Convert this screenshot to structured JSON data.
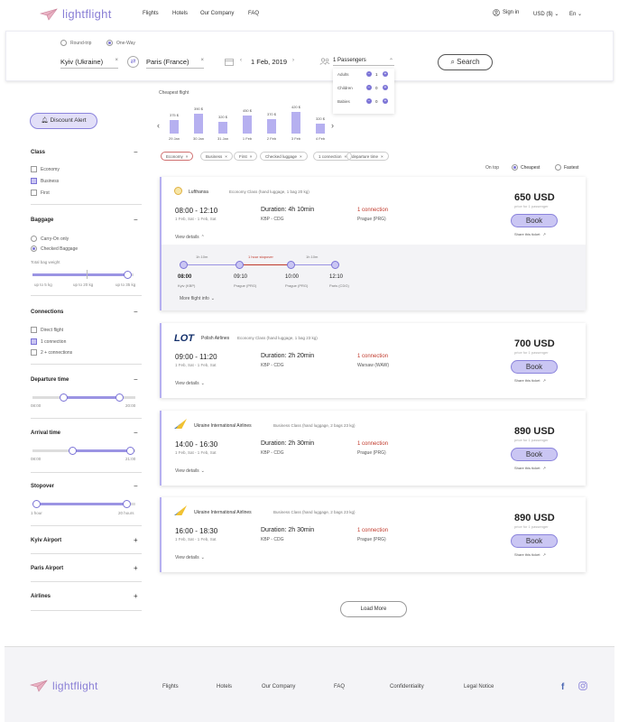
{
  "brand": {
    "name": "lightflight",
    "accent": "#8a7fd6"
  },
  "header": {
    "nav": [
      "Flights",
      "Hotels",
      "Our Company",
      "FAQ"
    ],
    "sign_in": "Sign in",
    "currency": "USD ($)",
    "language": "En"
  },
  "search": {
    "trip_round": "Round-trip",
    "trip_oneway": "One-Way",
    "from": "Kyiv (Ukraine)",
    "to": "Paris (France)",
    "date": "1 Feb, 2019",
    "passengers": "1 Passengers",
    "search_label": "Search",
    "pax_rows": [
      {
        "label": "Adults",
        "count": "1"
      },
      {
        "label": "Children",
        "count": "0"
      },
      {
        "label": "Babies",
        "count": "0"
      }
    ]
  },
  "sidebar": {
    "discount": "Discount Alert",
    "class_title": "Class",
    "class_items": [
      "Economy",
      "Business",
      "First"
    ],
    "baggage_title": "Baggage",
    "baggage_items": [
      "Carry-On only",
      "Checked Baggage"
    ],
    "total_weight": "Total bag weight",
    "weight_ticks": [
      "up to 5 kg",
      "up to 20 kg",
      "up to 35 kg"
    ],
    "connections_title": "Connections",
    "connections_items": [
      "Direct flight",
      "1 connection",
      "2 + connections"
    ],
    "departure_title": "Departure time",
    "departure_range": [
      "08:00",
      "20:00"
    ],
    "arrival_title": "Arrival time",
    "arrival_range": [
      "08:00",
      "21:00"
    ],
    "stopover_title": "Stopover",
    "stopover_range": [
      "1 hour",
      "20 hours"
    ],
    "kyiv_airport": "Kyiv Airport",
    "paris_airport": "Paris Airport",
    "airlines": "Airlines"
  },
  "cheapest_title": "Cheapest flight",
  "cheapest_bars": [
    {
      "price": "375 $",
      "date": "29 Jan",
      "height": 0.55
    },
    {
      "price": "390 $",
      "date": "30 Jan",
      "height": 0.78
    },
    {
      "price": "320 $",
      "date": "31 Jan",
      "height": 0.45
    },
    {
      "price": "450 $",
      "date": "1 Feb",
      "height": 0.72
    },
    {
      "price": "370 $",
      "date": "2 Feb",
      "height": 0.58
    },
    {
      "price": "420 $",
      "date": "3 Feb",
      "height": 0.85
    },
    {
      "price": "320 $",
      "date": "4 Feb",
      "height": 0.38
    }
  ],
  "chips": [
    "Economy",
    "Business",
    "First",
    "Checked luggage",
    "1 connection",
    "departure time"
  ],
  "sort": {
    "on_top": "On top",
    "cheapest": "Cheapest",
    "fastest": "Fastest"
  },
  "flights": [
    {
      "airline": "Lufthansa",
      "info": "Economy Class (hand luggage, 1 bag 20 kg)",
      "time": "08:00 - 12:10",
      "date": "1 Feb, Sat - 1 Feb, Sat",
      "duration": "Duration: 4h 10min",
      "route": "KBP - CDG",
      "connection": "1 connection",
      "via": "Prague (PRG)",
      "price": "650 USD",
      "price_sub": "price for 1 passenger",
      "book": "Book",
      "share": "Share this ticket",
      "details": "View details"
    },
    {
      "airline": "Polish Airlines",
      "info": "Economy Class (hand luggage, 1 bag 23 kg)",
      "time": "09:00 - 11:20",
      "date": "1 Feb, Sat - 1 Feb, Sat",
      "duration": "Duration: 2h 20min",
      "route": "KBP - CDG",
      "connection": "1 connection",
      "via": "Warsaw (WAW)",
      "price": "700 USD",
      "price_sub": "price for 1 passenger",
      "book": "Book",
      "share": "Share this ticket",
      "details": "View details"
    },
    {
      "airline": "Ukraine International Airlines",
      "info": "Business Class (hand luggage, 2 bags 23 kg)",
      "time": "14:00 - 16:30",
      "date": "1 Feb, Sat - 1 Feb, Sat",
      "duration": "Duration: 2h 30min",
      "route": "KBP - CDG",
      "connection": "1 connection",
      "via": "Prague (PRG)",
      "price": "890 USD",
      "price_sub": "price for 1 passenger",
      "book": "Book",
      "share": "Share this ticket",
      "details": "View details"
    },
    {
      "airline": "Ukraine International Airlines",
      "info": "Business Class (hand luggage, 2 bags 23 kg)",
      "time": "16:00 - 18:30",
      "date": "1 Feb, Sat - 1 Feb, Sat",
      "duration": "Duration: 2h 30min",
      "route": "KBP - CDG",
      "connection": "1 connection",
      "via": "Prague (PRG)",
      "price": "890 USD",
      "price_sub": "price for 1 passenger",
      "book": "Book",
      "share": "Share this ticket",
      "details": "View details"
    }
  ],
  "expanded": {
    "seg1": "1h 10m",
    "stopover": "1 hour stopover",
    "seg2": "1h 10m",
    "stops": [
      {
        "time": "08:00",
        "place": "Kyiv (KBP)"
      },
      {
        "time": "09:10",
        "place": "Prague (PRG)"
      },
      {
        "time": "10:00",
        "place": "Prague (PRG)"
      },
      {
        "time": "12:10",
        "place": "Paris (CDG)"
      }
    ],
    "more": "More flight info"
  },
  "load_more": "Load More",
  "footer": {
    "links": [
      "Flights",
      "Hotels",
      "Our Company",
      "FAQ",
      "Confidentiality",
      "Legal Notice"
    ]
  }
}
